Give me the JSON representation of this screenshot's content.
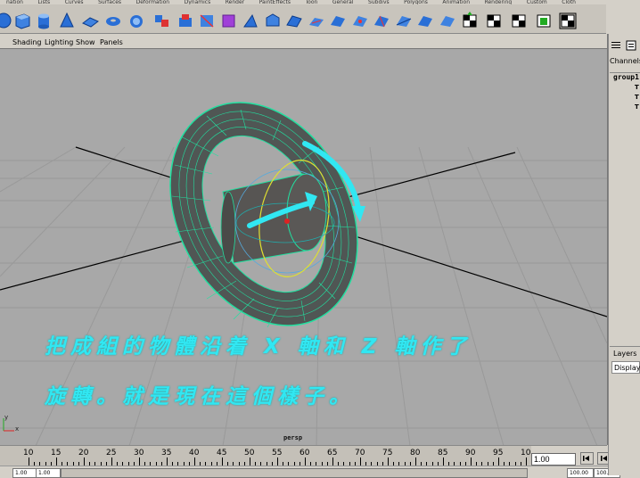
{
  "shelf_tabs": [
    "nation",
    "Lists",
    "Curves",
    "Surfaces",
    "Deformation",
    "Dynamics",
    "Render",
    "PaintEffects",
    "Toon",
    "General",
    "Subdivs",
    "Polygons",
    "Animation",
    "Rendering",
    "Custom",
    "Cloth"
  ],
  "panel_menu": {
    "view": "",
    "shading": "Shading",
    "lighting": "Lighting",
    "show": "Show",
    "panels": "Panels"
  },
  "viewport": {
    "camera_label": "persp",
    "caption_line1": "把成組的物體沿着 X 軸和 Z 軸作了",
    "caption_line2": "旋轉。就是現在這個樣子。",
    "caption_color": "#31e7f2",
    "background_color": "#a8a8a8",
    "wireframe_color": "#22e0a0",
    "axis_labels": {
      "y": "y",
      "x": "x"
    }
  },
  "timeline": {
    "ticks": [
      "10",
      "15",
      "20",
      "25",
      "30",
      "35",
      "40",
      "45",
      "50",
      "55",
      "60",
      "65",
      "70",
      "75",
      "80",
      "85",
      "90",
      "95",
      "10"
    ],
    "current_frame": "1.00"
  },
  "range_slider": {
    "start": "1.00",
    "end": "1.00",
    "range_start": "1.00",
    "range_end": "1.00",
    "field_a": "100.00",
    "field_b": "100.00"
  },
  "channel_box": {
    "tab_label": "Channels",
    "object_name": "group1",
    "attrs": [
      "T",
      "T",
      "T"
    ]
  },
  "layers": {
    "label": "Layers",
    "display_button": "Display"
  },
  "playback_icons": [
    "go-to-start-icon",
    "step-back-icon",
    "play-back-icon"
  ]
}
